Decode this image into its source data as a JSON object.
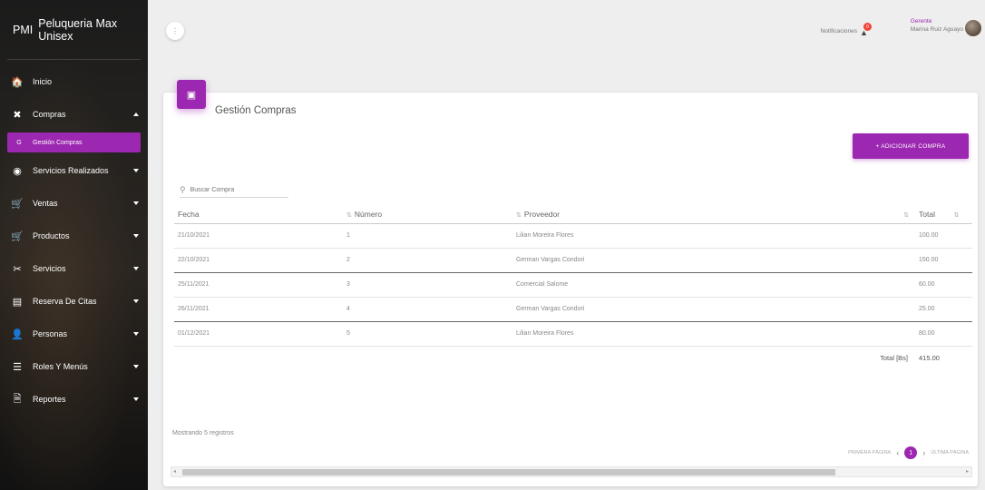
{
  "app": {
    "abbr": "PMI",
    "name": "Peluqueria Max Unisex"
  },
  "sidebar": {
    "items": [
      {
        "label": "Inicio",
        "icon": "home-icon",
        "glyph": "🏠"
      },
      {
        "label": "Compras",
        "icon": "cart-off-icon",
        "glyph": "✖"
      },
      {
        "label": "Gestión Compras",
        "icon": "letter-g-icon",
        "glyph": "G"
      },
      {
        "label": "Servicios Realizados",
        "icon": "clock-icon",
        "glyph": "◉"
      },
      {
        "label": "Ventas",
        "icon": "cart-icon",
        "glyph": "🛒"
      },
      {
        "label": "Productos",
        "icon": "shopping-cart-icon",
        "glyph": "🛒"
      },
      {
        "label": "Servicios",
        "icon": "scissors-icon",
        "glyph": "✂"
      },
      {
        "label": "Reserva De Citas",
        "icon": "calendar-icon",
        "glyph": "▤"
      },
      {
        "label": "Personas",
        "icon": "person-icon",
        "glyph": "👤"
      },
      {
        "label": "Roles Y Menús",
        "icon": "list-icon",
        "glyph": "☰"
      },
      {
        "label": "Reportes",
        "icon": "document-icon",
        "glyph": "🗎"
      }
    ]
  },
  "topbar": {
    "menu_glyph": "⋮",
    "notifications_label": "Notificaciones",
    "notifications_count": "0",
    "user_role": "Gerente",
    "user_name": "Marina Ruiz Aguayo"
  },
  "main": {
    "title": "Gestión Compras",
    "add_button": "+ ADICIONAR COMPRA",
    "search_placeholder": "Buscar Compra",
    "columns": [
      "Fecha",
      "Número",
      "Proveedor",
      "Total"
    ],
    "rows": [
      {
        "fecha": "21/10/2021",
        "numero": "1",
        "proveedor": "Lilian Moreira Flores",
        "total": "100.00"
      },
      {
        "fecha": "22/10/2021",
        "numero": "2",
        "proveedor": "German Vargas Condori",
        "total": "150.00"
      },
      {
        "fecha": "25/11/2021",
        "numero": "3",
        "proveedor": "Comercial Salome",
        "total": "60.00"
      },
      {
        "fecha": "26/11/2021",
        "numero": "4",
        "proveedor": "German Vargas Condori",
        "total": "25.00"
      },
      {
        "fecha": "01/12/2021",
        "numero": "5",
        "proveedor": "Lilian Moreira Flores",
        "total": "80.00"
      }
    ],
    "total_label": "Total [Bs]",
    "total_value": "415.00",
    "showing_text": "Mostrando 5 registros",
    "pager": {
      "first": "PRIMERA PÁGINA",
      "current": "1",
      "last": "ÚLTIMA PÁGINA"
    }
  },
  "colors": {
    "accent": "#9c27b0",
    "badge": "#f44336"
  }
}
